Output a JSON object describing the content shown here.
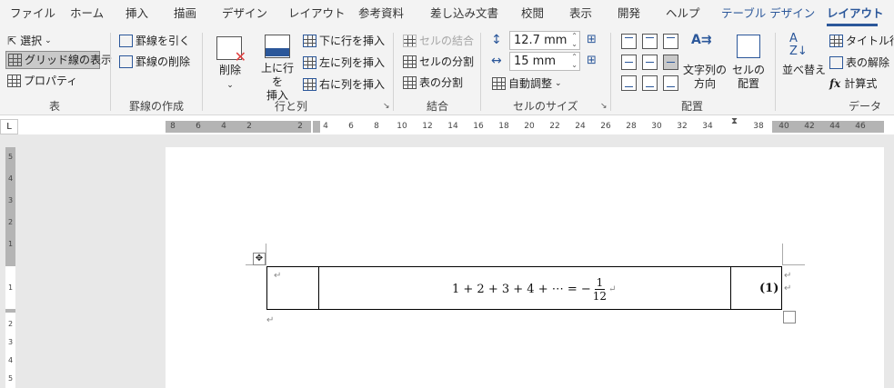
{
  "tabs": [
    "ファイル",
    "ホーム",
    "挿入",
    "描画",
    "デザイン",
    "レイアウト",
    "参考資料",
    "差し込み文書",
    "校閲",
    "表示",
    "開発",
    "ヘルプ",
    "テーブル デザイン",
    "レイアウト"
  ],
  "groups": {
    "table": {
      "label": "表",
      "select": "選択",
      "gridlines": "グリッド線の表示",
      "properties": "プロパティ"
    },
    "draw": {
      "label": "罫線の作成",
      "draw_table": "罫線を引く",
      "eraser": "罫線の削除"
    },
    "rows_cols": {
      "label": "行と列",
      "delete": "削除",
      "insert_above": "上に行を\n挿入",
      "insert_below": "下に行を挿入",
      "insert_left": "左に列を挿入",
      "insert_right": "右に列を挿入"
    },
    "merge": {
      "label": "結合",
      "merge_cells": "セルの結合",
      "split_cells": "セルの分割",
      "split_table": "表の分割"
    },
    "cell_size": {
      "label": "セルのサイズ",
      "height": "12.7 mm",
      "width": "15 mm",
      "autofit": "自動調整"
    },
    "alignment": {
      "label": "配置",
      "text_direction": "文字列の\n方向",
      "cell_margins": "セルの\n配置"
    },
    "data": {
      "label": "データ",
      "sort": "並べ替え",
      "repeat_header": "タイトル行の",
      "convert": "表の解除",
      "formula": "計算式"
    }
  },
  "ruler": {
    "corner": "L",
    "top_left": [
      "8",
      "6",
      "4",
      "2"
    ],
    "top_right": [
      "2",
      "4",
      "6",
      "8",
      "10",
      "12",
      "14",
      "16",
      "18",
      "20",
      "22",
      "24",
      "26",
      "28",
      "30",
      "32",
      "34",
      "38",
      "40",
      "42",
      "44",
      "46"
    ],
    "left": [
      "5",
      "4",
      "3",
      "2",
      "1",
      "1",
      "2",
      "3",
      "4",
      "5"
    ]
  },
  "document": {
    "equation_lhs": "1 + 2 + 3 + 4 + ⋯ = −",
    "fraction_num": "1",
    "fraction_den": "12",
    "equation_number": "(1)",
    "para_mark": "↵",
    "move_handle": "✥"
  }
}
